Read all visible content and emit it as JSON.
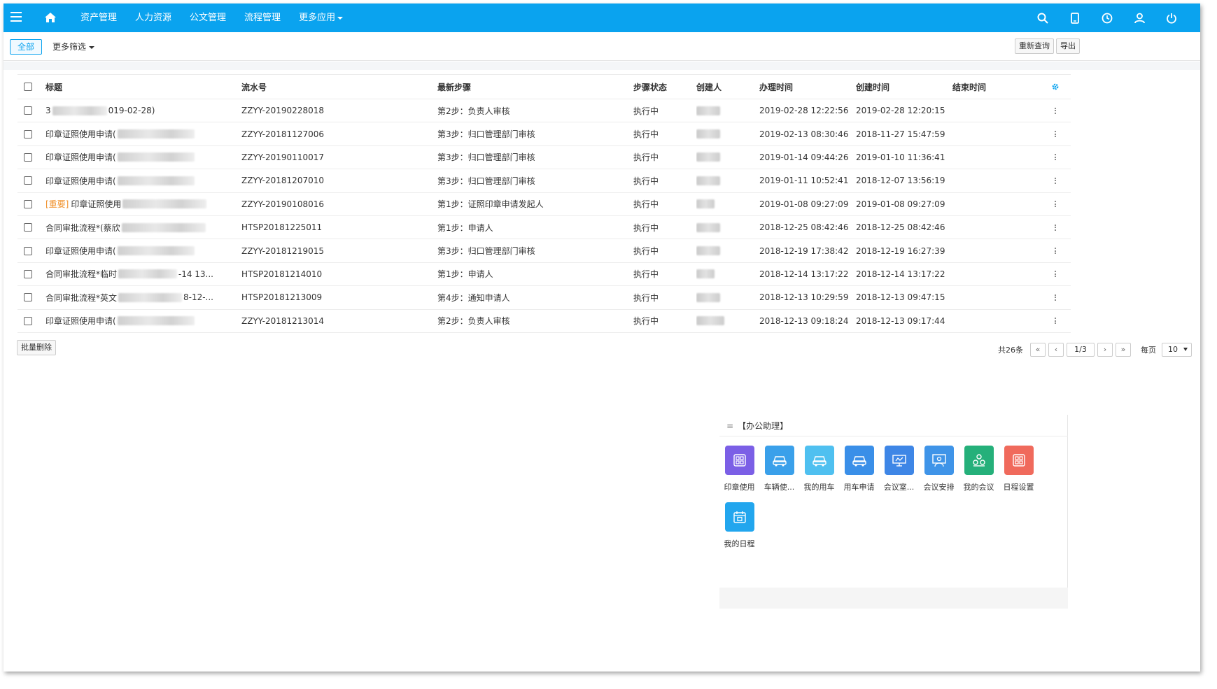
{
  "nav": {
    "items": [
      "资产管理",
      "人力资源",
      "公文管理",
      "流程管理",
      "更多应用"
    ]
  },
  "filter": {
    "all_label": "全部",
    "more_label": "更多筛选",
    "requery_label": "重新查询",
    "export_label": "导出"
  },
  "table": {
    "headers": {
      "title": "标题",
      "serial": "流水号",
      "step": "最新步骤",
      "status": "步骤状态",
      "creator": "创建人",
      "handle_time": "办理时间",
      "create_time": "创建时间",
      "end_time": "结束时间"
    },
    "rows": [
      {
        "tag": "",
        "title_prefix": "3",
        "title_suffix": "019-02-28)",
        "serial": "ZZYY-20190228018",
        "step": "第2步：负责人审核",
        "status": "执行中",
        "handle_time": "2019-02-28 12:22:56",
        "create_time": "2019-02-28 12:20:15",
        "end_time": ""
      },
      {
        "tag": "",
        "title_prefix": "印章证照使用申请(",
        "title_suffix": "",
        "serial": "ZZYY-20181127006",
        "step": "第3步：归口管理部门审核",
        "status": "执行中",
        "handle_time": "2019-02-13 08:30:46",
        "create_time": "2018-11-27 15:47:59",
        "end_time": ""
      },
      {
        "tag": "",
        "title_prefix": "印章证照使用申请(",
        "title_suffix": "",
        "serial": "ZZYY-20190110017",
        "step": "第3步：归口管理部门审核",
        "status": "执行中",
        "handle_time": "2019-01-14 09:44:26",
        "create_time": "2019-01-10 11:36:41",
        "end_time": ""
      },
      {
        "tag": "",
        "title_prefix": "印章证照使用申请(",
        "title_suffix": "",
        "serial": "ZZYY-20181207010",
        "step": "第3步：归口管理部门审核",
        "status": "执行中",
        "handle_time": "2019-01-11 10:52:41",
        "create_time": "2018-12-07 13:56:19",
        "end_time": ""
      },
      {
        "tag": "[重要]",
        "title_prefix": "印章证照使用",
        "title_suffix": "",
        "serial": "ZZYY-20190108016",
        "step": "第1步：证照印章申请发起人",
        "status": "执行中",
        "handle_time": "2019-01-08 09:27:09",
        "create_time": "2019-01-08 09:27:09",
        "end_time": ""
      },
      {
        "tag": "",
        "title_prefix": "合同审批流程*(蔡欣",
        "title_suffix": "",
        "serial": "HTSP20181225011",
        "step": "第1步：申请人",
        "status": "执行中",
        "handle_time": "2018-12-25 08:42:46",
        "create_time": "2018-12-25 08:42:46",
        "end_time": ""
      },
      {
        "tag": "",
        "title_prefix": "印章证照使用申请(",
        "title_suffix": "",
        "serial": "ZZYY-20181219015",
        "step": "第3步：归口管理部门审核",
        "status": "执行中",
        "handle_time": "2018-12-19 17:38:42",
        "create_time": "2018-12-19 16:27:39",
        "end_time": ""
      },
      {
        "tag": "",
        "title_prefix": "合同审批流程*临时",
        "title_suffix": "-14 13...",
        "serial": "HTSP20181214010",
        "step": "第1步：申请人",
        "status": "执行中",
        "handle_time": "2018-12-14 13:17:22",
        "create_time": "2018-12-14 13:17:22",
        "end_time": ""
      },
      {
        "tag": "",
        "title_prefix": "合同审批流程*英文",
        "title_suffix": "8-12-...",
        "serial": "HTSP20181213009",
        "step": "第4步：通知申请人",
        "status": "执行中",
        "handle_time": "2018-12-13 10:29:59",
        "create_time": "2018-12-13 09:47:15",
        "end_time": ""
      },
      {
        "tag": "",
        "title_prefix": "印章证照使用申请(",
        "title_suffix": "",
        "serial": "ZZYY-20181213014",
        "step": "第2步：负责人审核",
        "status": "执行中",
        "handle_time": "2018-12-13 09:18:24",
        "create_time": "2018-12-13 09:17:44",
        "end_time": ""
      }
    ]
  },
  "batch_delete_label": "批量删除",
  "pager": {
    "total": "共26条",
    "first": "«",
    "prev": "‹",
    "page": "1/3",
    "next": "›",
    "last": "»",
    "per_page_label": "每页",
    "per_page_value": "10"
  },
  "assistant": {
    "title": "【办公助理】",
    "apps": [
      {
        "label": "印章使用",
        "color": "#7b5fe6",
        "icon": "grid-icon"
      },
      {
        "label": "车辆使...",
        "color": "#3aa0ea",
        "icon": "car-icon"
      },
      {
        "label": "我的用车",
        "color": "#4fc0f0",
        "icon": "car-icon"
      },
      {
        "label": "用车申请",
        "color": "#3a8fe8",
        "icon": "car-icon"
      },
      {
        "label": "会议室...",
        "color": "#3e86e6",
        "icon": "projector-icon"
      },
      {
        "label": "会议安排",
        "color": "#3f94e8",
        "icon": "meeting-icon"
      },
      {
        "label": "我的会议",
        "color": "#25b07a",
        "icon": "people-icon"
      },
      {
        "label": "日程设置",
        "color": "#f06a5c",
        "icon": "grid-icon"
      },
      {
        "label": "我的日程",
        "color": "#22a6ee",
        "icon": "calendar-icon"
      }
    ]
  },
  "colors": {
    "brand": "#0aa3ef",
    "important_tag": "#f0902a"
  }
}
